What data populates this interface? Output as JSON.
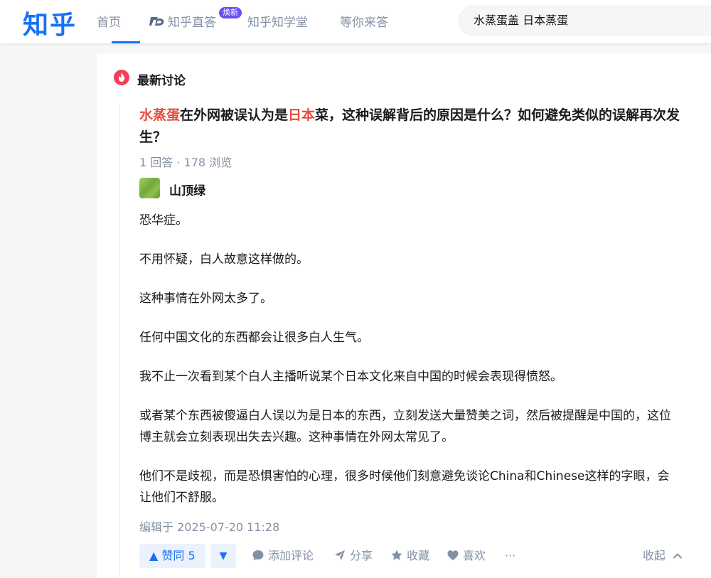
{
  "header": {
    "logo": "知乎",
    "nav": [
      {
        "label": "首页"
      },
      {
        "label": "知乎直答"
      },
      {
        "label": "知乎知学堂"
      },
      {
        "label": "等你来答"
      }
    ],
    "new_badge": "焕新",
    "search_value": "水蒸蛋盖 日本蒸蛋"
  },
  "section": {
    "title": "最新讨论"
  },
  "question": {
    "title_parts": [
      "水蒸蛋",
      "在外网被误认为是",
      "日本",
      "菜，这种误解背后的原因是什么？如何避免类似的误解再次发生？"
    ],
    "meta": "1 回答 · 178 浏览"
  },
  "answer": {
    "author": "山顶绿",
    "paragraphs": [
      "恐华症。",
      "不用怀疑，白人故意这样做的。",
      "这种事情在外网太多了。",
      "任何中国文化的东西都会让很多白人生气。",
      "我不止一次看到某个白人主播听说某个日本文化来自中国的时候会表现得愤怒。",
      "或者某个东西被傻逼白人误以为是日本的东西，立刻发送大量赞美之词，然后被提醒是中国的，这位博主就会立刻表现出失去兴趣。这种事情在外网太常见了。",
      "他们不是歧视，而是恐惧害怕的心理，很多时候他们刻意避免谈论China和Chinese这样的字眼，会让他们不舒服。"
    ],
    "edited": "编辑于 2025-07-20 11:28"
  },
  "actions": {
    "upvote": "▲ 赞同 5",
    "downvote": "▼",
    "comment": "添加评论",
    "share": "分享",
    "favorite": "收藏",
    "like": "喜欢",
    "more": "···",
    "collapse": "收起"
  },
  "colors": {
    "brand": "#1772f6",
    "highlight": "#e74c3c",
    "muted": "#8491a5"
  }
}
